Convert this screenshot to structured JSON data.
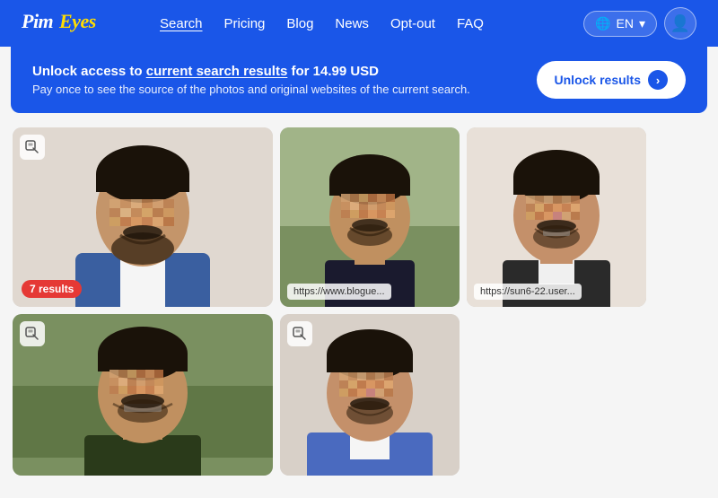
{
  "navbar": {
    "logo": "PimEyes",
    "links": [
      {
        "label": "Search",
        "active": true
      },
      {
        "label": "Pricing",
        "active": false
      },
      {
        "label": "Blog",
        "active": false
      },
      {
        "label": "News",
        "active": false
      },
      {
        "label": "Opt-out",
        "active": false
      },
      {
        "label": "FAQ",
        "active": false
      }
    ],
    "language": "EN",
    "user_icon": "👤"
  },
  "banner": {
    "title_prefix": "Unlock access to ",
    "title_link": "current search results",
    "title_suffix": " for 14.99 USD",
    "subtitle": "Pay once to see the source of the photos and original websites of the current search.",
    "unlock_label": "Unlock results"
  },
  "results": {
    "cards": [
      {
        "id": "large",
        "badge": "7 results",
        "url": null,
        "has_icon": true
      },
      {
        "id": "medium-a",
        "badge": null,
        "url": "https://www.blogue...",
        "has_icon": false
      },
      {
        "id": "medium-b",
        "badge": null,
        "url": "https://sun6-22.user...",
        "has_icon": false
      },
      {
        "id": "bottom-a",
        "badge": null,
        "url": null,
        "has_icon": true
      },
      {
        "id": "bottom-b",
        "badge": null,
        "url": null,
        "has_icon": true
      }
    ]
  },
  "icons": {
    "globe": "🌐",
    "chevron_down": "▾",
    "user": "👤",
    "search": "🔍",
    "arrow_right": "›"
  }
}
